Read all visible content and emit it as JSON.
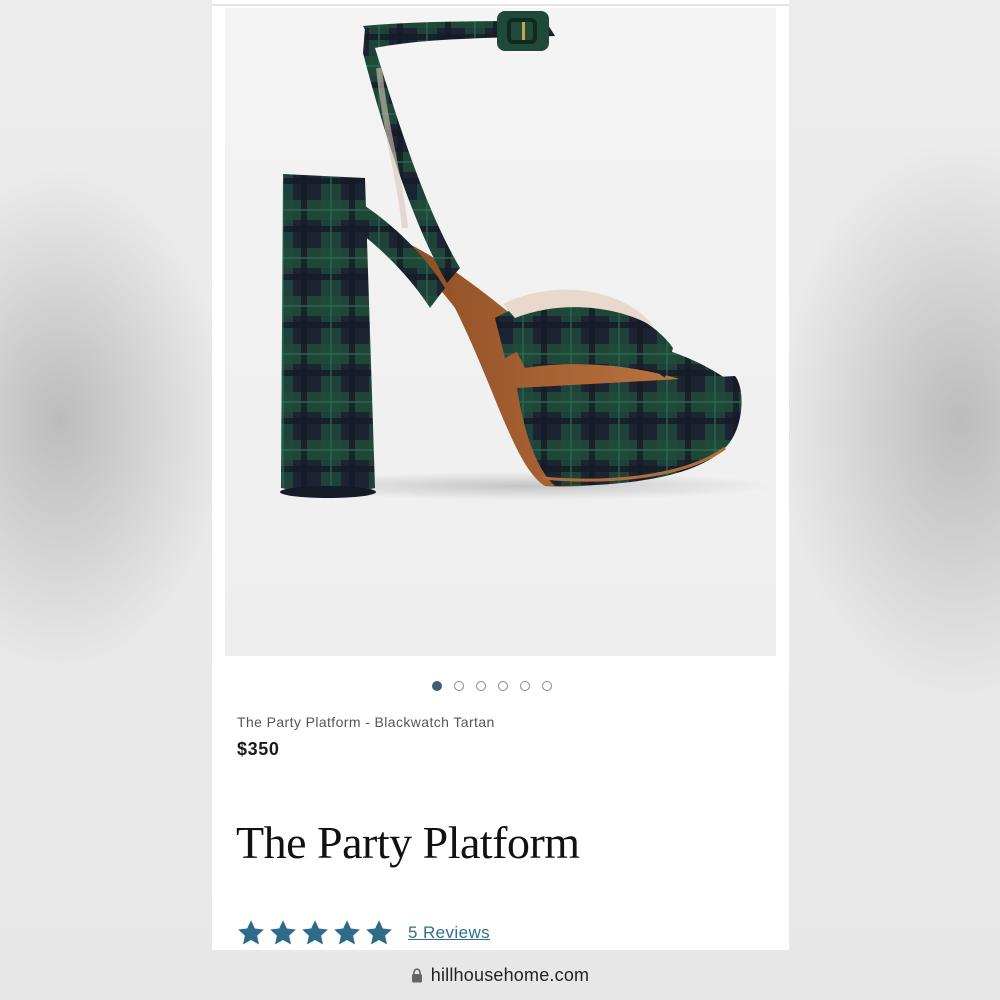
{
  "product": {
    "image_alt": "Blackwatch tartan platform sandal",
    "variant_name": "The Party Platform - Blackwatch Tartan",
    "price": "$350",
    "title": "The Party Platform",
    "carousel": {
      "total_images": 6,
      "active_index": 0
    },
    "rating": {
      "stars": 5,
      "max_stars": 5,
      "reviews_label": "5 Reviews"
    }
  },
  "browser": {
    "url": "hillhousehome.com"
  },
  "icons": {
    "lock": "lock-icon",
    "star": "star-icon"
  },
  "colors": {
    "accent": "#2f6f8a",
    "dot_active": "#3f5e76",
    "star": "#2e6b88",
    "tartan_green": "#1f4a3a",
    "tartan_navy": "#1c2332"
  }
}
